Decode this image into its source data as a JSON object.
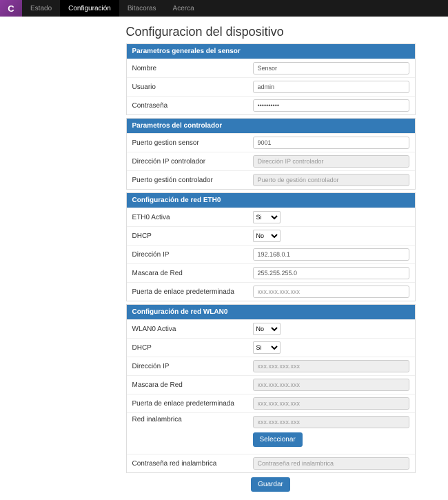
{
  "nav": {
    "logo": "C",
    "items": [
      "Estado",
      "Configuración",
      "Bitacoras",
      "Acerca"
    ],
    "activeIndex": 1
  },
  "title": "Configuracion del dispositivo",
  "sections": {
    "sensor": {
      "heading": "Parametros generales del sensor",
      "nombre_label": "Nombre",
      "nombre_value": "Sensor",
      "usuario_label": "Usuario",
      "usuario_value": "admin",
      "contrasena_label": "Contraseña",
      "contrasena_value": "••••••••••"
    },
    "controller": {
      "heading": "Parametros del controlador",
      "puerto_sensor_label": "Puerto gestion sensor",
      "puerto_sensor_value": "9001",
      "ip_label": "Dirección IP controlador",
      "ip_placeholder": "Dirección IP controlador",
      "puerto_ctrl_label": "Puerto gestión controlador",
      "puerto_ctrl_placeholder": "Puerto de gestión controlador"
    },
    "eth0": {
      "heading": "Configuración de red ETH0",
      "activa_label": "ETH0 Activa",
      "activa_value": "Si",
      "dhcp_label": "DHCP",
      "dhcp_value": "No",
      "ip_label": "Dirección IP",
      "ip_value": "192.168.0.1",
      "mask_label": "Mascara de Red",
      "mask_value": "255.255.255.0",
      "gateway_label": "Puerta de enlace predeterminada",
      "gateway_placeholder": "xxx.xxx.xxx.xxx"
    },
    "wlan0": {
      "heading": "Configuración de red WLAN0",
      "activa_label": "WLAN0 Activa",
      "activa_value": "No",
      "dhcp_label": "DHCP",
      "dhcp_value": "Si",
      "ip_label": "Dirección IP",
      "ip_placeholder": "xxx.xxx.xxx.xxx",
      "mask_label": "Mascara de Red",
      "mask_placeholder": "xxx.xxx.xxx.xxx",
      "gateway_label": "Puerta de enlace predeterminada",
      "gateway_placeholder": "xxx.xxx.xxx.xxx",
      "ssid_label": "Red inalambrica",
      "ssid_placeholder": "xxx.xxx.xxx.xxx",
      "select_btn": "Seleccionar",
      "pass_label": "Contraseña red inalambrica",
      "pass_placeholder": "Contraseña red inalambrica"
    }
  },
  "save_btn": "Guardar",
  "options": {
    "yesno": [
      "Si",
      "No"
    ]
  }
}
